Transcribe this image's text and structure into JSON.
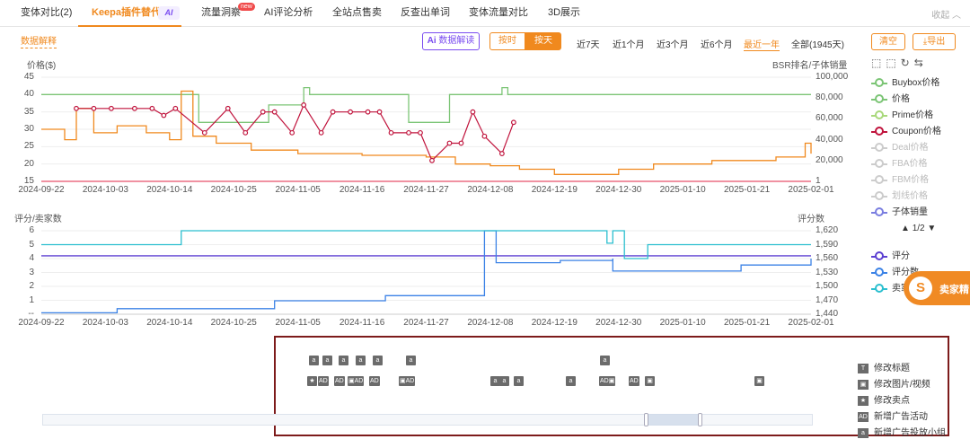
{
  "tabs": [
    {
      "label": "变体对比(2)"
    },
    {
      "label": "Keepa插件替代",
      "badge": "AI"
    },
    {
      "label": "流量洞察",
      "badge": "new"
    },
    {
      "label": "AI评论分析"
    },
    {
      "label": "全站点售卖"
    },
    {
      "label": "反查出单词"
    },
    {
      "label": "变体流量对比"
    },
    {
      "label": "3D展示"
    }
  ],
  "collapse_label": "收起",
  "toolbar": {
    "interpret_link": "数据解释",
    "ai_button": "数据解读",
    "ai_glyph": "Ai",
    "mode_hourly": "按时",
    "mode_daily": "按天",
    "ranges": [
      "近7天",
      "近1个月",
      "近3个月",
      "近6个月",
      "最近一年",
      "全部(1945天)"
    ],
    "selected_range": "最近一年",
    "clear_button": "清空",
    "export_button": "导出"
  },
  "chart_data": [
    {
      "type": "line",
      "ylabel_left": "价格($)",
      "ylabel_right": "BSR排名/子体销量",
      "x_ticks": [
        "2024-09-22",
        "2024-10-03",
        "2024-10-14",
        "2024-10-25",
        "2024-11-05",
        "2024-11-16",
        "2024-11-27",
        "2024-12-08",
        "2024-12-19",
        "2024-12-30",
        "2025-01-10",
        "2025-01-21",
        "2025-02-01"
      ],
      "y_left_ticks": [
        45,
        40,
        35,
        30,
        25,
        20,
        15
      ],
      "y_right_ticks": [
        "100,000",
        "80,000",
        "60,000",
        "40,000",
        "20,000",
        "1"
      ],
      "ylim_left": [
        15,
        45
      ],
      "ylim_right": [
        1,
        100000
      ],
      "series": [
        {
          "name": "Buybox价格",
          "color": "#7cc576",
          "kind": "step",
          "x": [
            "2024-09-22",
            "2024-10-17",
            "2024-10-19",
            "2024-10-31",
            "2024-11-06",
            "2024-11-07",
            "2024-11-24",
            "2024-12-01",
            "2024-12-10",
            "2024-12-11"
          ],
          "y": [
            40,
            40,
            32,
            37,
            42,
            40,
            32,
            40,
            42,
            40
          ]
        },
        {
          "name": "价格",
          "color": "#f0891e",
          "kind": "step",
          "x": [
            "2024-09-22",
            "2024-09-26",
            "2024-09-28",
            "2024-10-01",
            "2024-10-05",
            "2024-10-10",
            "2024-10-14",
            "2024-10-16",
            "2024-10-18",
            "2024-10-22",
            "2024-10-28",
            "2024-11-05",
            "2024-11-16",
            "2024-11-27",
            "2024-12-02",
            "2024-12-08",
            "2024-12-13",
            "2024-12-19",
            "2024-12-30",
            "2025-01-05",
            "2025-01-15",
            "2025-01-26",
            "2025-01-31",
            "2025-02-01"
          ],
          "y": [
            30,
            27,
            36,
            29,
            31,
            29,
            27,
            41,
            28,
            26,
            24,
            23,
            22.5,
            22,
            20,
            19.5,
            18.5,
            17,
            18.5,
            20,
            21,
            22,
            26,
            23
          ]
        },
        {
          "name": "Coupon价格",
          "color": "#c0133c",
          "kind": "marker",
          "x": [
            "2024-09-28",
            "2024-10-01",
            "2024-10-04",
            "2024-10-08",
            "2024-10-11",
            "2024-10-13",
            "2024-10-15",
            "2024-10-20",
            "2024-10-24",
            "2024-10-27",
            "2024-10-30",
            "2024-11-01",
            "2024-11-04",
            "2024-11-06",
            "2024-11-09",
            "2024-11-11",
            "2024-11-14",
            "2024-11-17",
            "2024-11-19",
            "2024-11-21",
            "2024-11-24",
            "2024-11-26",
            "2024-11-28",
            "2024-12-01",
            "2024-12-03",
            "2024-12-05",
            "2024-12-07",
            "2024-12-10",
            "2024-12-12"
          ],
          "y": [
            36,
            36,
            36,
            36,
            36,
            34,
            36,
            29,
            36,
            29,
            35,
            35,
            29,
            37,
            29,
            35,
            35,
            35,
            35,
            29,
            29,
            29,
            21,
            26,
            26,
            35,
            28,
            23,
            32
          ]
        }
      ],
      "flat_line": {
        "name": "子体销量",
        "color": "#e8506a",
        "y": 15
      }
    },
    {
      "type": "line",
      "ylabel_left": "评分/卖家数",
      "ylabel_right": "评分数",
      "x_ticks": [
        "2024-09-22",
        "2024-10-03",
        "2024-10-14",
        "2024-10-25",
        "2024-11-05",
        "2024-11-16",
        "2024-11-27",
        "2024-12-08",
        "2024-12-19",
        "2024-12-30",
        "2025-01-10",
        "2025-01-21",
        "2025-02-01"
      ],
      "y_left_ticks": [
        "6",
        "5",
        "4",
        "3",
        "2",
        "1",
        "--"
      ],
      "y_right_ticks": [
        "1,620",
        "1,590",
        "1,560",
        "1,530",
        "1,500",
        "1,470",
        "1,440"
      ],
      "ylim_left": [
        0,
        6
      ],
      "ylim_right": [
        1440,
        1620
      ],
      "series": [
        {
          "name": "评分",
          "color": "#5b3fd1",
          "kind": "flat",
          "y": 4.2
        },
        {
          "name": "评分数",
          "color": "#3b82e6",
          "kind": "step-right",
          "x": [
            "2024-09-22",
            "2024-10-05",
            "2024-10-05",
            "2024-11-01",
            "2024-11-20",
            "2024-12-07",
            "2024-12-07",
            "2024-12-09",
            "2024-12-20",
            "2024-12-29",
            "2024-12-29",
            "2025-01-20",
            "2025-02-01"
          ],
          "y": [
            1443,
            1443,
            1452,
            1469,
            1480,
            1491,
            1620,
            1551,
            1556,
            1560,
            1533,
            1546,
            1560
          ]
        },
        {
          "name": "卖家数",
          "color": "#2bbfcf",
          "kind": "step",
          "x": [
            "2024-09-22",
            "2024-10-16",
            "2024-12-28",
            "2024-12-29",
            "2024-12-31",
            "2025-01-04",
            "2025-01-05",
            "2025-02-01"
          ],
          "y": [
            5,
            6,
            5.1,
            6,
            4,
            5,
            5,
            5
          ]
        }
      ]
    }
  ],
  "legend_main": [
    {
      "name": "Buybox价格",
      "color": "#7cc576",
      "on": true
    },
    {
      "name": "价格",
      "color": "#7cc576",
      "on": true
    },
    {
      "name": "Prime价格",
      "color": "#a8d87a",
      "on": true
    },
    {
      "name": "Coupon价格",
      "color": "#c0133c",
      "on": true
    },
    {
      "name": "Deal价格",
      "color": "#ccc",
      "on": false
    },
    {
      "name": "FBA价格",
      "color": "#ccc",
      "on": false
    },
    {
      "name": "FBM价格",
      "color": "#ccc",
      "on": false
    },
    {
      "name": "划线价格",
      "color": "#ccc",
      "on": false
    },
    {
      "name": "子体销量",
      "color": "#7a7ee0",
      "on": true
    }
  ],
  "legend_pager": "1/2",
  "legend_second": [
    {
      "name": "评分",
      "color": "#5b3fd1"
    },
    {
      "name": "评分数",
      "color": "#3b82e6"
    },
    {
      "name": "卖家数",
      "color": "#2bbfcf"
    }
  ],
  "float_badge": "卖家精",
  "event_legend": [
    {
      "key": "T",
      "label": "修改标题"
    },
    {
      "key": "▣",
      "label": "修改图片/视频"
    },
    {
      "key": "★",
      "label": "修改卖点"
    },
    {
      "key": "AD",
      "label": "新增广告活动"
    },
    {
      "key": "a",
      "label": "新增广告投放小组"
    }
  ],
  "events_row1": [
    "a",
    "a",
    "a",
    "a",
    "a",
    "a",
    "a"
  ],
  "events_row2": [
    "★",
    "AD",
    "AD",
    "▣AD",
    "AD",
    "▣AD",
    "a",
    "a",
    "a",
    "a",
    "AD▣",
    "AD",
    "▣",
    "▣"
  ]
}
